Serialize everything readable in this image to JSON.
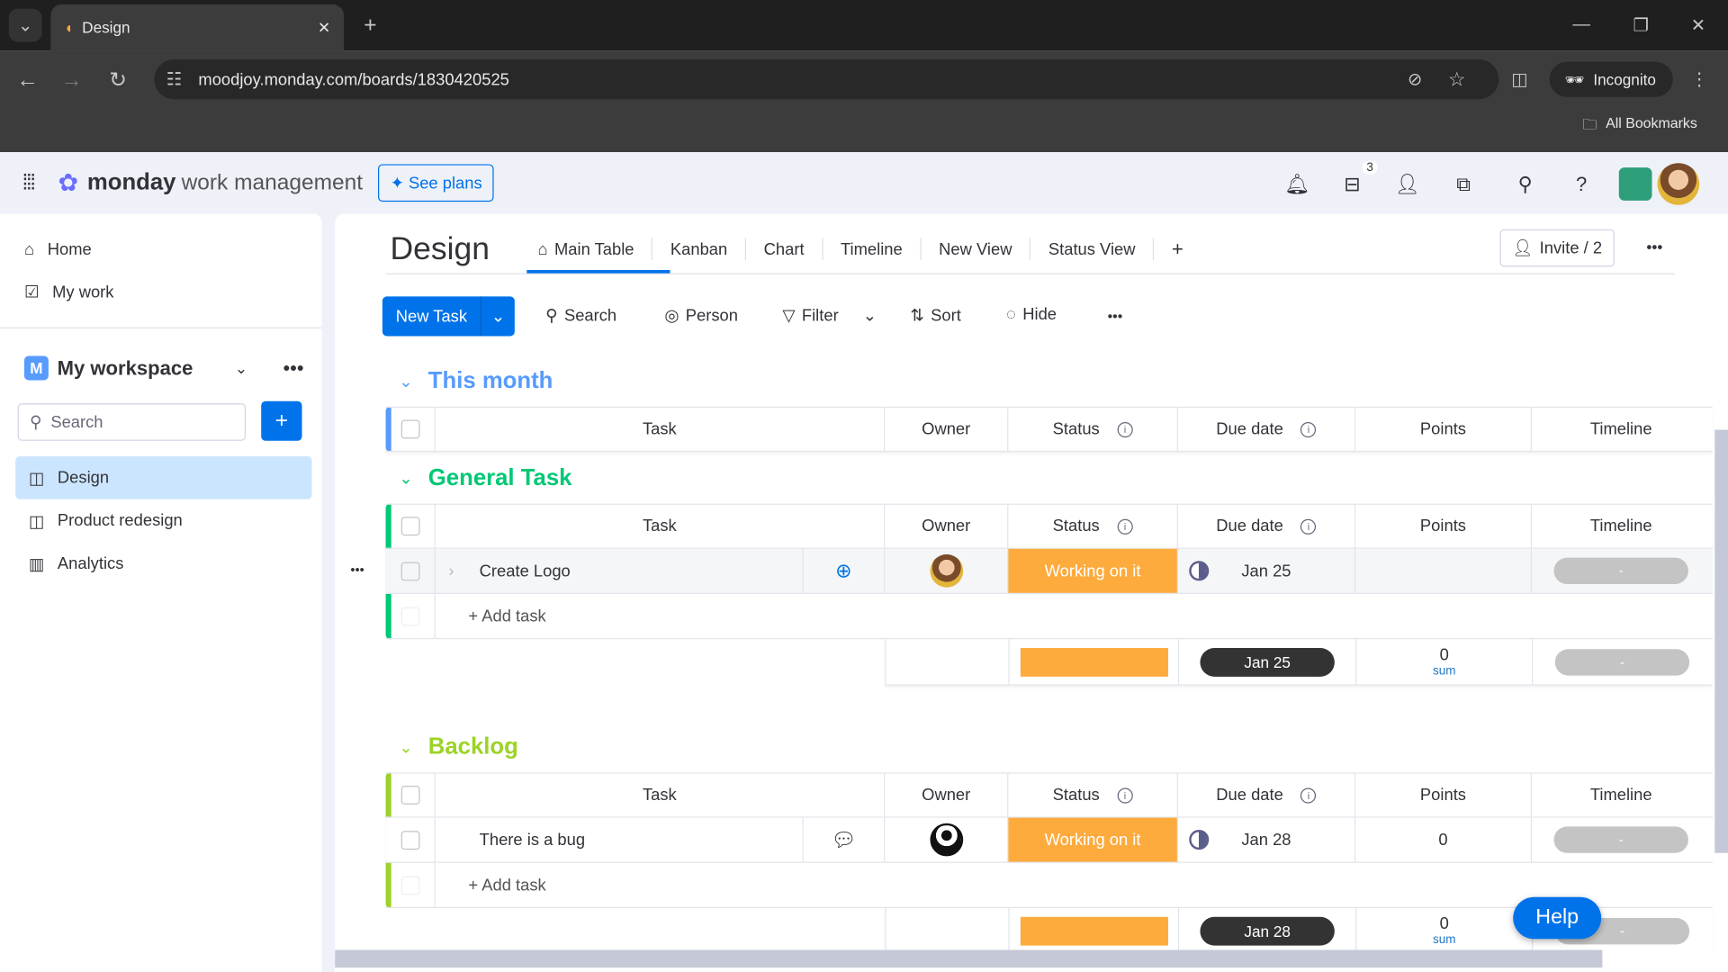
{
  "browser": {
    "tab_title": "Design",
    "url": "moodjoy.monday.com/boards/1830420525",
    "incognito_label": "Incognito",
    "bookmarks_label": "All Bookmarks"
  },
  "app": {
    "brand_bold": "monday",
    "brand_light": "work management",
    "see_plans": "See plans",
    "inbox_badge": "3"
  },
  "sidebar": {
    "home": "Home",
    "my_work": "My work",
    "workspace": "My workspace",
    "workspace_initial": "M",
    "search_placeholder": "Search",
    "boards": [
      {
        "label": "Design",
        "active": true
      },
      {
        "label": "Product redesign"
      },
      {
        "label": "Analytics"
      }
    ]
  },
  "board": {
    "title": "Design",
    "tabs": [
      "Main Table",
      "Kanban",
      "Chart",
      "Timeline",
      "New View",
      "Status View"
    ],
    "add_tab": "+",
    "invite": "Invite / 2",
    "toolbar": {
      "new_task": "New Task",
      "search": "Search",
      "person": "Person",
      "filter": "Filter",
      "sort": "Sort",
      "hide": "Hide"
    }
  },
  "columns": [
    "Task",
    "Owner",
    "Status",
    "Due date",
    "Points",
    "Timeline"
  ],
  "groups": [
    {
      "title": "This month",
      "color": "#579bfc",
      "items": [],
      "add_task": null,
      "summary": null
    },
    {
      "title": "General Task",
      "color": "#00c875",
      "items": [
        {
          "name": "Create Logo",
          "owner": "avatar",
          "status": "Working on it",
          "due": "Jan 25",
          "points": "",
          "timeline": "-"
        }
      ],
      "add_task": "+ Add task",
      "summary": {
        "due": "Jan 25",
        "points": "0",
        "points_label": "sum",
        "timeline": "-"
      }
    },
    {
      "title": "Backlog",
      "color": "#9cd326",
      "items": [
        {
          "name": "There is a bug",
          "owner": "person",
          "status": "Working on it",
          "due": "Jan 28",
          "points": "0",
          "timeline": "-"
        }
      ],
      "add_task": "+ Add task",
      "summary": {
        "due": "Jan 28",
        "points": "0",
        "points_label": "sum",
        "timeline": "-"
      }
    }
  ],
  "colors": {
    "primary": "#0073ea",
    "working_on_it": "#fdab3d",
    "date_pill": "#333333"
  },
  "help": "Help"
}
